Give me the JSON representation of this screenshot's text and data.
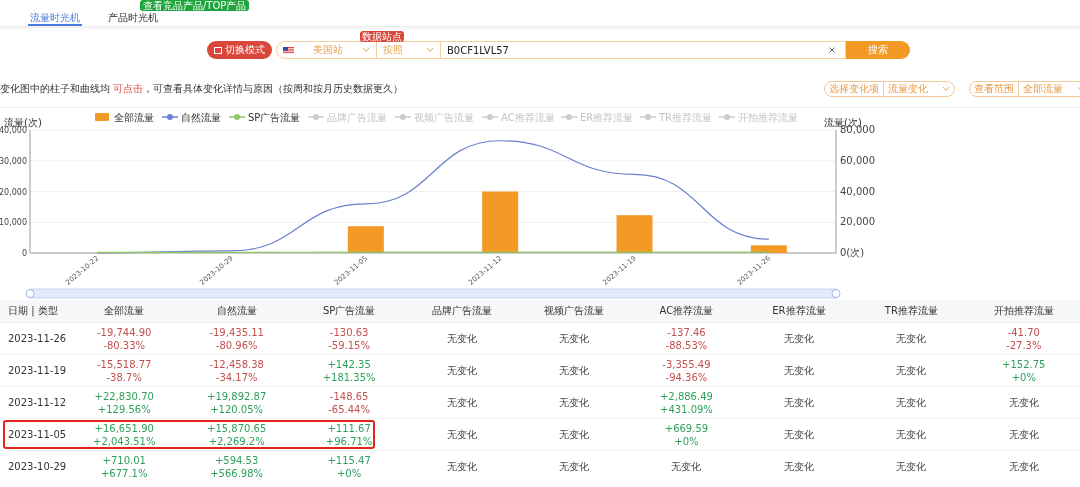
{
  "tabs": [
    {
      "label": "流量时光机",
      "selected": true
    },
    {
      "label": "产品时光机",
      "selected": false,
      "badge": "查看竞品产品/TOP产品"
    }
  ],
  "search": {
    "mode_button": "切换模式",
    "site": {
      "value": "美国站",
      "badge": "数据站点"
    },
    "type": {
      "value": "按照"
    },
    "query": {
      "value": "B0CF1LVL57"
    },
    "button": "搜索"
  },
  "hint": {
    "parts": [
      {
        "text": "变化图中的柱子和曲线均 ",
        "highlight": false
      },
      {
        "text": "可点击",
        "highlight": true
      },
      {
        "text": "，可查看具体变化详情与原因（按周和按月历史数据更久）",
        "highlight": false
      }
    ]
  },
  "filters": [
    {
      "label": "选择变化项",
      "value": "流量变化"
    },
    {
      "label": "查看范围",
      "value": "全部流量"
    }
  ],
  "chart": {
    "chart_data": {
      "type": "bar",
      "ylabel": "流量(次)",
      "categories": [
        "2023-10-22",
        "2023-10-29",
        "2023-11-05",
        "2023-11-12",
        "2023-11-19",
        "2023-11-26"
      ],
      "series": [
        {
          "name": "全部流量",
          "color": "#f39a26",
          "values": [
            null,
            null,
            8700,
            20000,
            12300,
            2500
          ]
        },
        {
          "name": "自然流量",
          "color": "#6b80d0",
          "type": "line",
          "values": [
            0,
            700,
            16000,
            36500,
            25600,
            4500
          ]
        },
        {
          "name": "SP广告流量",
          "color": "#8cc665",
          "type": "line",
          "values": [
            200,
            200,
            300,
            300,
            300,
            300
          ]
        }
      ],
      "ylim": [
        0,
        40000
      ],
      "grid": true,
      "legend": "top",
      "yticks": [
        {
          "value": 0,
          "label": "0"
        },
        {
          "value": 10000,
          "label": "10,000"
        },
        {
          "value": 20000,
          "label": "20,000"
        },
        {
          "value": 30000,
          "label": "30,000"
        },
        {
          "value": 40000,
          "label": "40,000"
        }
      ]
    },
    "inactive_legend": [
      "品牌广告流量",
      "视频广告流量",
      "AC推荐流量",
      "ER推荐流量",
      "TR推荐流量",
      "开拍推荐流量"
    ],
    "right_axis": {
      "title": "流量(次)",
      "ticks": [
        "80,000",
        "60,000",
        "40,000",
        "20,000",
        "0(次)"
      ]
    }
  },
  "table": {
    "columns": [
      "日期 | 类型",
      "全部流量",
      "自然流量",
      "SP广告流量",
      "品牌广告流量",
      "视频广告流量",
      "AC推荐流量",
      "ER推荐流量",
      "TR推荐流量",
      "开拍推荐流量"
    ],
    "rows": [
      {
        "highlighted": false,
        "cells": [
          {
            "kind": "date",
            "text": "2023-11-26"
          },
          {
            "kind": "change",
            "color": "#c0504d",
            "value": "-19,744.90",
            "percent": "-80.33%"
          },
          {
            "kind": "change",
            "color": "#c0504d",
            "value": "-19,435.11",
            "percent": "-80.96%"
          },
          {
            "kind": "change",
            "color": "#c0504d",
            "value": "-130.63",
            "percent": "-59.15%"
          },
          {
            "kind": "none",
            "text": "无变化"
          },
          {
            "kind": "none",
            "text": "无变化"
          },
          {
            "kind": "change",
            "color": "#c0504d",
            "value": "-137.46",
            "percent": "-88.53%"
          },
          {
            "kind": "none",
            "text": "无变化"
          },
          {
            "kind": "none",
            "text": "无变化"
          },
          {
            "kind": "change",
            "color": "#c0504d",
            "value": "-41.70",
            "percent": "-27.3%"
          }
        ]
      },
      {
        "highlighted": false,
        "cells": [
          {
            "kind": "date",
            "text": "2023-11-19"
          },
          {
            "kind": "change",
            "color": "#c0504d",
            "value": "-15,518.77",
            "percent": "-38.7%"
          },
          {
            "kind": "change",
            "color": "#c0504d",
            "value": "-12,458.38",
            "percent": "-34.17%"
          },
          {
            "kind": "change",
            "color": "#2e9e5b",
            "value": "+142.35",
            "percent": "+181.35%"
          },
          {
            "kind": "none",
            "text": "无变化"
          },
          {
            "kind": "none",
            "text": "无变化"
          },
          {
            "kind": "change",
            "color": "#c0504d",
            "value": "-3,355.49",
            "percent": "-94.36%"
          },
          {
            "kind": "none",
            "text": "无变化"
          },
          {
            "kind": "none",
            "text": "无变化"
          },
          {
            "kind": "change",
            "color": "#2e9e5b",
            "value": "+152.75",
            "percent": "+0%"
          }
        ]
      },
      {
        "highlighted": false,
        "cells": [
          {
            "kind": "date",
            "text": "2023-11-12"
          },
          {
            "kind": "change",
            "color": "#2e9e5b",
            "value": "+22,830.70",
            "percent": "+129.56%"
          },
          {
            "kind": "change",
            "color": "#2e9e5b",
            "value": "+19,892.87",
            "percent": "+120.05%"
          },
          {
            "kind": "change",
            "color": "#c0504d",
            "value": "-148.65",
            "percent": "-65.44%"
          },
          {
            "kind": "none",
            "text": "无变化"
          },
          {
            "kind": "none",
            "text": "无变化"
          },
          {
            "kind": "change",
            "color": "#2e9e5b",
            "value": "+2,886.49",
            "percent": "+431.09%"
          },
          {
            "kind": "none",
            "text": "无变化"
          },
          {
            "kind": "none",
            "text": "无变化"
          },
          {
            "kind": "none",
            "text": "无变化"
          }
        ]
      },
      {
        "highlighted": true,
        "cells": [
          {
            "kind": "date",
            "text": "2023-11-05"
          },
          {
            "kind": "change",
            "color": "#2e9e5b",
            "value": "+16,651.90",
            "percent": "+2,043.51%"
          },
          {
            "kind": "change",
            "color": "#2e9e5b",
            "value": "+15,870.65",
            "percent": "+2,269.2%"
          },
          {
            "kind": "change",
            "color": "#2e9e5b",
            "value": "+111.67",
            "percent": "+96.71%"
          },
          {
            "kind": "none",
            "text": "无变化"
          },
          {
            "kind": "none",
            "text": "无变化"
          },
          {
            "kind": "change",
            "color": "#2e9e5b",
            "value": "+669.59",
            "percent": "+0%"
          },
          {
            "kind": "none",
            "text": "无变化"
          },
          {
            "kind": "none",
            "text": "无变化"
          },
          {
            "kind": "none",
            "text": "无变化"
          }
        ]
      },
      {
        "highlighted": false,
        "cells": [
          {
            "kind": "date",
            "text": "2023-10-29"
          },
          {
            "kind": "change",
            "color": "#2e9e5b",
            "value": "+710.01",
            "percent": "+677.1%"
          },
          {
            "kind": "change",
            "color": "#2e9e5b",
            "value": "+594.53",
            "percent": "+566.98%"
          },
          {
            "kind": "change",
            "color": "#2e9e5b",
            "value": "+115.47",
            "percent": "+0%"
          },
          {
            "kind": "none",
            "text": "无变化"
          },
          {
            "kind": "none",
            "text": "无变化"
          },
          {
            "kind": "none",
            "text": "无变化"
          },
          {
            "kind": "none",
            "text": "无变化"
          },
          {
            "kind": "none",
            "text": "无变化"
          },
          {
            "kind": "none",
            "text": "无变化"
          }
        ]
      }
    ]
  }
}
